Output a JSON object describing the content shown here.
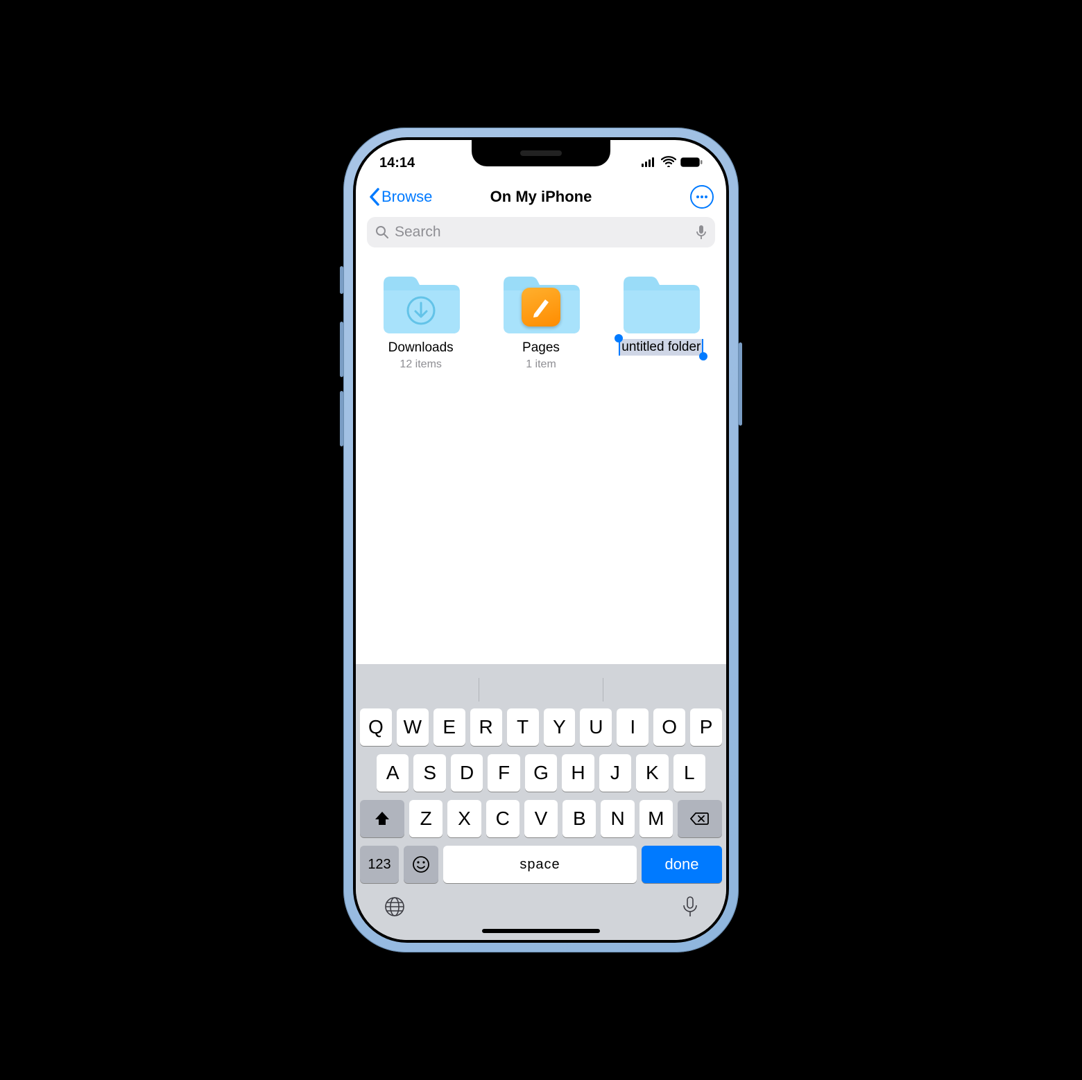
{
  "status": {
    "time": "14:14"
  },
  "nav": {
    "back": "Browse",
    "title": "On My iPhone"
  },
  "search": {
    "placeholder": "Search"
  },
  "folders": [
    {
      "name": "Downloads",
      "subtitle": "12 items",
      "kind": "downloads"
    },
    {
      "name": "Pages",
      "subtitle": "1 item",
      "kind": "pages"
    },
    {
      "name": "untitled folder",
      "subtitle": "",
      "kind": "editing"
    }
  ],
  "keyboard": {
    "rows": [
      [
        "Q",
        "W",
        "E",
        "R",
        "T",
        "Y",
        "U",
        "I",
        "O",
        "P"
      ],
      [
        "A",
        "S",
        "D",
        "F",
        "G",
        "H",
        "J",
        "K",
        "L"
      ],
      [
        "Z",
        "X",
        "C",
        "V",
        "B",
        "N",
        "M"
      ]
    ],
    "numKey": "123",
    "space": "space",
    "done": "done"
  }
}
